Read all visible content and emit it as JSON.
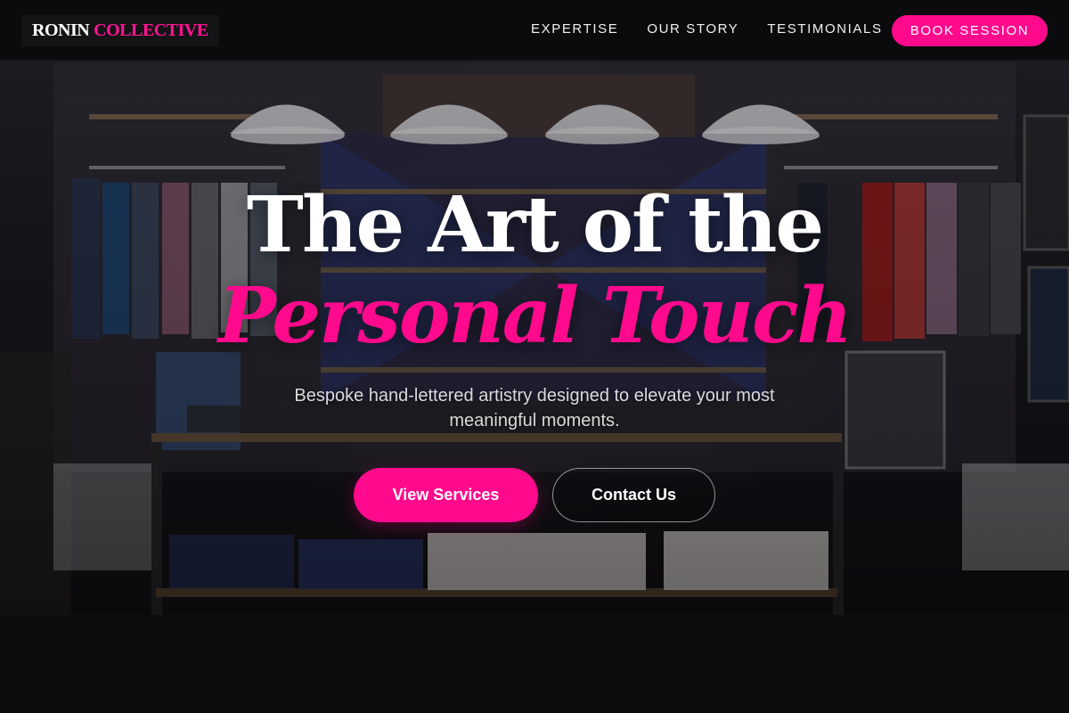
{
  "brand": {
    "name_part1": "RONIN",
    "name_part2": "COLLECTIVE"
  },
  "nav": {
    "links": [
      {
        "label": "EXPERTISE"
      },
      {
        "label": "OUR STORY"
      },
      {
        "label": "TESTIMONIALS"
      }
    ],
    "cta_label": "BOOK SESSION"
  },
  "hero": {
    "headline_line1": "The Art of the",
    "headline_line2": "Personal Touch",
    "subtitle": "Bespoke hand-lettered artistry designed to elevate your most meaningful moments.",
    "primary_button": "View Services",
    "secondary_button": "Contact Us"
  },
  "colors": {
    "accent": "#ff0a8c",
    "nav_bg": "#0a0a0c",
    "text": "#ffffff"
  }
}
